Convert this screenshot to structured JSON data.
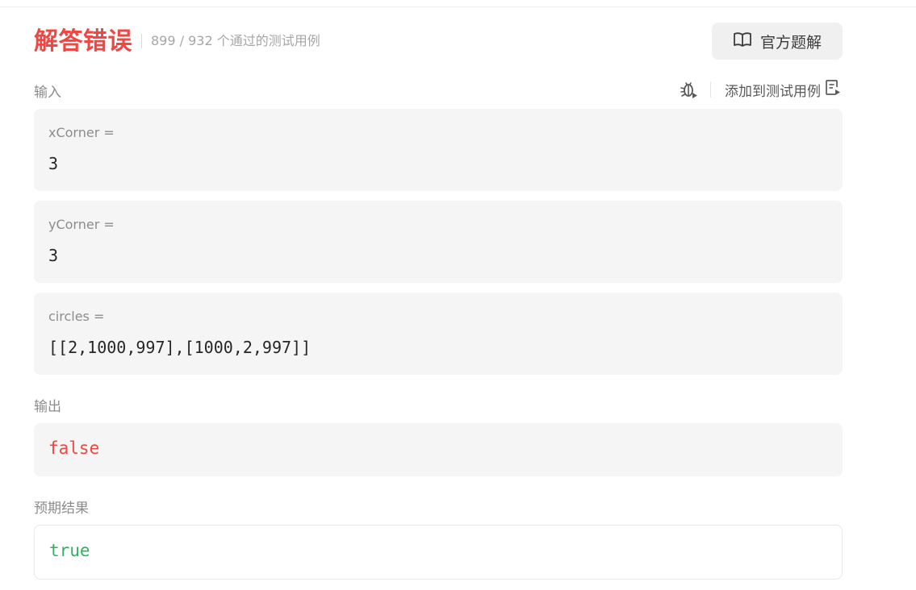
{
  "header": {
    "status": "解答错误",
    "passed": "899",
    "total": "932",
    "pass_suffix": "个通过的测试用例",
    "official_solution_label": "官方题解"
  },
  "input_section": {
    "label": "输入",
    "add_to_testcase_label": "添加到测试用例",
    "params": [
      {
        "name": "xCorner =",
        "value": "3"
      },
      {
        "name": "yCorner =",
        "value": "3"
      },
      {
        "name": "circles =",
        "value": "[[2,1000,997],[1000,2,997]]"
      }
    ]
  },
  "output_section": {
    "label": "输出",
    "value": "false"
  },
  "expected_section": {
    "label": "预期结果",
    "value": "true"
  },
  "colors": {
    "status_error": "#ef4743",
    "output_value": "#ef4743",
    "expected_value": "#2db55d",
    "box_bg": "#f5f5f5"
  },
  "icons": [
    "book-icon",
    "debug-icon",
    "add-testcase-icon"
  ]
}
